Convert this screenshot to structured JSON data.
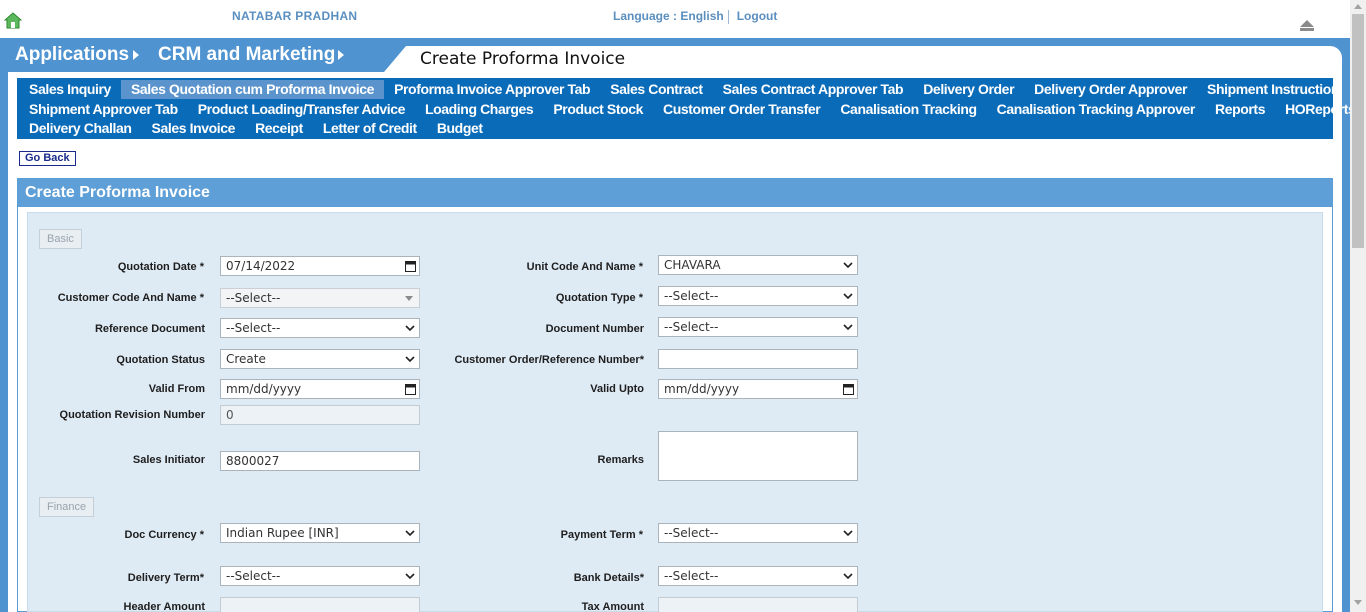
{
  "header": {
    "user_name": "NATABAR PRADHAN",
    "language_label": "Language :",
    "language_value": "English",
    "logout_label": "Logout"
  },
  "breadcrumb": {
    "items": [
      "Applications",
      "CRM and Marketing"
    ],
    "page_title": "Create Proforma Invoice"
  },
  "menu": {
    "rows": [
      [
        "Sales Inquiry",
        "Sales Quotation cum Proforma Invoice",
        "Proforma Invoice Approver Tab",
        "Sales Contract",
        "Sales Contract Approver Tab",
        "Delivery Order",
        "Delivery Order Approver",
        "Shipment Instruction"
      ],
      [
        "Shipment Approver Tab",
        "Product Loading/Transfer Advice",
        "Loading Charges",
        "Product Stock",
        "Customer Order Transfer",
        "Canalisation Tracking",
        "Canalisation Tracking Approver",
        "Reports",
        "HOReports"
      ],
      [
        "Delivery Challan",
        "Sales Invoice",
        "Receipt",
        "Letter of Credit",
        "Budget"
      ]
    ],
    "active": "Sales Quotation cum Proforma Invoice"
  },
  "go_back_label": "Go Back",
  "panel": {
    "title": "Create Proforma Invoice",
    "sections": {
      "basic": "Basic",
      "finance": "Finance"
    }
  },
  "form": {
    "quotation_date": {
      "label": "Quotation Date *",
      "value": "07/14/2022"
    },
    "unit_code": {
      "label": "Unit Code And Name *",
      "value": "CHAVARA"
    },
    "customer_code": {
      "label": "Customer Code And Name *",
      "value": "--Select--"
    },
    "quotation_type": {
      "label": "Quotation Type *",
      "value": "--Select--"
    },
    "reference_document": {
      "label": "Reference Document",
      "value": "--Select--"
    },
    "document_number": {
      "label": "Document Number",
      "value": "--Select--"
    },
    "quotation_status": {
      "label": "Quotation Status",
      "value": "Create"
    },
    "customer_order_ref": {
      "label": "Customer Order/Reference Number*",
      "value": ""
    },
    "valid_from": {
      "label": "Valid From",
      "value": "mm/dd/yyyy"
    },
    "valid_upto": {
      "label": "Valid Upto",
      "value": "mm/dd/yyyy"
    },
    "revision_number": {
      "label": "Quotation Revision Number",
      "value": "0"
    },
    "sales_initiator": {
      "label": "Sales Initiator",
      "value": "8800027"
    },
    "remarks": {
      "label": "Remarks",
      "value": ""
    },
    "doc_currency": {
      "label": "Doc Currency *",
      "value": "Indian Rupee [INR]"
    },
    "payment_term": {
      "label": "Payment Term *",
      "value": "--Select--"
    },
    "delivery_term": {
      "label": "Delivery Term*",
      "value": "--Select--"
    },
    "bank_details": {
      "label": "Bank Details*",
      "value": "--Select--"
    },
    "header_amount": {
      "label": "Header Amount",
      "value": ""
    },
    "tax_amount": {
      "label": "Tax Amount",
      "value": ""
    }
  },
  "colors": {
    "frame_blue": "#4f93d0",
    "menu_blue": "#0a6bb9",
    "menu_active": "#5b94cc",
    "panel_head": "#5d9fd6",
    "form_bg": "#deeaf4"
  }
}
